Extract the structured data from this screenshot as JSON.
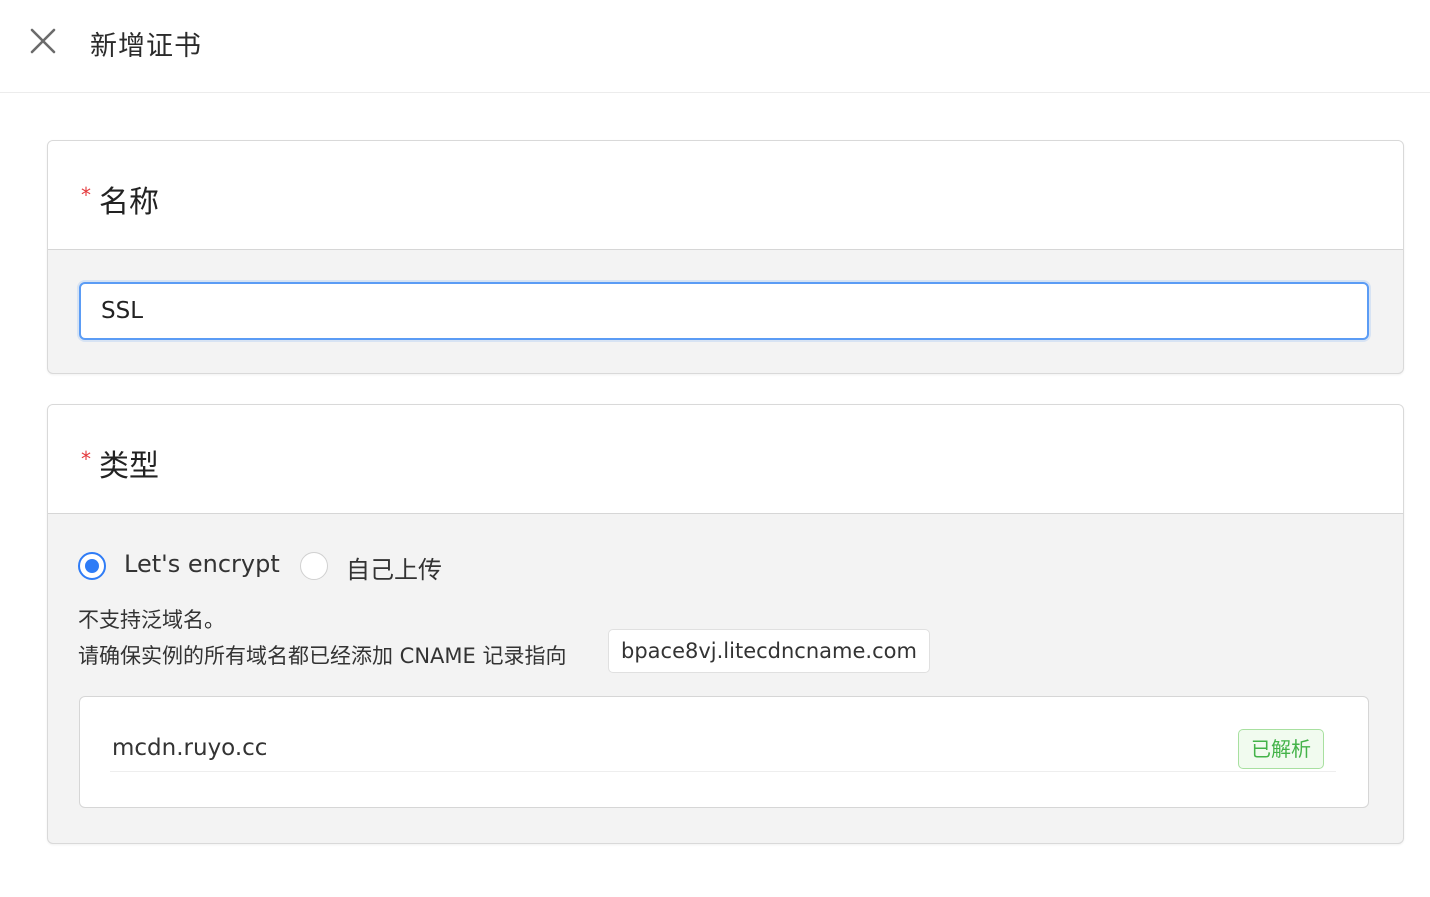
{
  "header": {
    "title": "新增证书",
    "close_icon": "close-icon"
  },
  "name_field": {
    "label": "名称",
    "required_mark": "*",
    "value": "SSL"
  },
  "type_field": {
    "label": "类型",
    "required_mark": "*",
    "options": [
      {
        "label": "Let's encrypt",
        "checked": true
      },
      {
        "label": "自己上传",
        "checked": false
      }
    ],
    "note_wildcard": "不支持泛域名。",
    "note_cname": "请确保实例的所有域名都已经添加 CNAME 记录指向",
    "cname_target": "bpace8vj.litecdncname.com",
    "domains": [
      {
        "domain": "mcdn.ruyo.cc",
        "status": "已解析"
      }
    ]
  },
  "colors": {
    "accent": "#2f7cf6",
    "required": "#e4393c",
    "success": "#44b349"
  }
}
